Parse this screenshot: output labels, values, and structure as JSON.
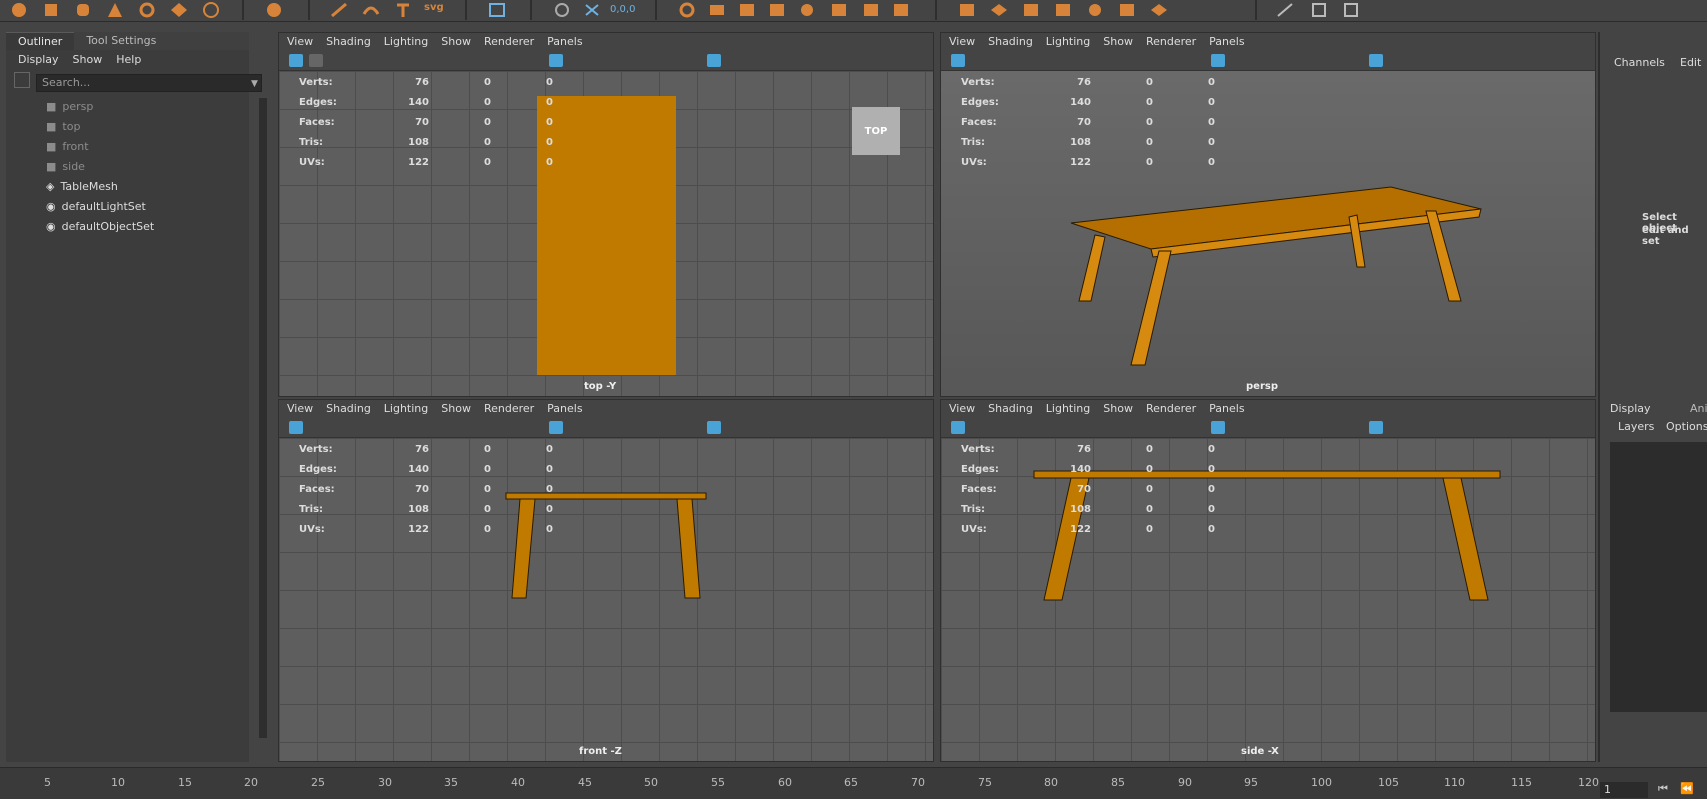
{
  "shelf": {
    "icons": [
      "sphere-icon",
      "cube-icon",
      "cylinder-icon",
      "cone-icon",
      "torus-icon",
      "plane-icon",
      "disc-icon",
      "soccer-ball-icon",
      "move-tool-icon",
      "curve-icon",
      "text-icon",
      "svg-icon",
      "grid-icon",
      "snap-icon",
      "snap-together-icon",
      "coordinate-icon",
      "deform-icon",
      "layer-icon",
      "cube-stack-icon",
      "lattice-icon",
      "shrink-icon",
      "plane-grid-icon",
      "extrude-icon",
      "bevel-icon",
      "bridge-icon",
      "multi-cut-icon",
      "target-weld-icon",
      "mirror-icon",
      "pen-icon",
      "bookend-icon",
      "square-icon"
    ],
    "svg_label": "svg",
    "coord_label": "0,0,0",
    "accent": "#d7843a"
  },
  "outliner": {
    "tabs": [
      "Outliner",
      "Tool Settings"
    ],
    "menu": [
      "Display",
      "Show",
      "Help"
    ],
    "search_placeholder": "Search...",
    "items": [
      {
        "label": "persp",
        "icon": "camera-icon",
        "type": "cam"
      },
      {
        "label": "top",
        "icon": "camera-icon",
        "type": "cam"
      },
      {
        "label": "front",
        "icon": "camera-icon",
        "type": "cam"
      },
      {
        "label": "side",
        "icon": "camera-icon",
        "type": "cam"
      },
      {
        "label": "TableMesh",
        "icon": "mesh-icon",
        "type": "mesh"
      },
      {
        "label": "defaultLightSet",
        "icon": "set-icon",
        "type": "set"
      },
      {
        "label": "defaultObjectSet",
        "icon": "set-icon",
        "type": "set"
      }
    ]
  },
  "viewport_menu": [
    "View",
    "Shading",
    "Lighting",
    "Show",
    "Renderer",
    "Panels"
  ],
  "hud": {
    "rows": [
      {
        "label": "Verts:",
        "a": "76",
        "b": "0",
        "c": "0"
      },
      {
        "label": "Edges:",
        "a": "140",
        "b": "0",
        "c": "0"
      },
      {
        "label": "Faces:",
        "a": "70",
        "b": "0",
        "c": "0"
      },
      {
        "label": "Tris:",
        "a": "108",
        "b": "0",
        "c": "0"
      },
      {
        "label": "UVs:",
        "a": "122",
        "b": "0",
        "c": "0"
      }
    ]
  },
  "viewports": {
    "top": {
      "label": "top -Y",
      "cube_label": "TOP"
    },
    "persp": {
      "label": "persp"
    },
    "front": {
      "label": "front -Z"
    },
    "side": {
      "label": "side -X"
    }
  },
  "right_panel": {
    "tabs": [
      "Channels",
      "Edit"
    ],
    "hint_line1": "Select object",
    "hint_line2": "edit and set",
    "display_tabs": [
      "Display",
      "Anim"
    ],
    "layer_menu": [
      "Layers",
      "Options"
    ]
  },
  "timeline": {
    "ticks": [
      "5",
      "10",
      "15",
      "20",
      "25",
      "30",
      "35",
      "40",
      "45",
      "50",
      "55",
      "60",
      "65",
      "70",
      "75",
      "80",
      "85",
      "90",
      "95",
      "100",
      "105",
      "110",
      "115",
      "120"
    ],
    "current_frame": "1"
  },
  "colors": {
    "mesh": "#c07a00",
    "viewport_bg": "#5d5d5d",
    "panel_bg": "#444444",
    "active_blue": "#4aa3d6"
  }
}
